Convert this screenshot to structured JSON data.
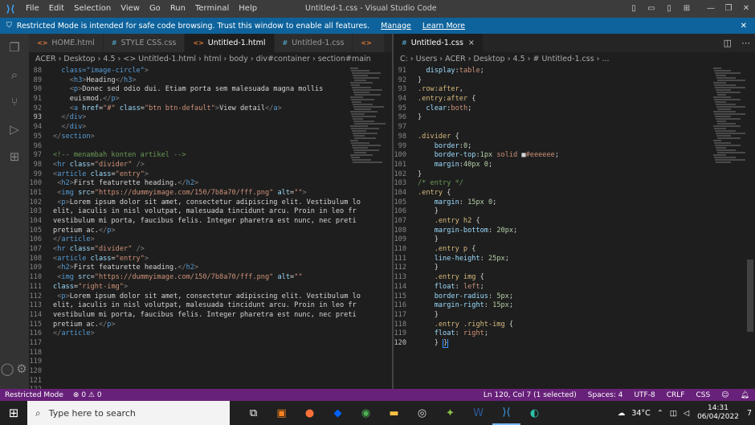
{
  "titlebar": {
    "logo": "vscode-icon",
    "menu": [
      "File",
      "Edit",
      "Selection",
      "View",
      "Go",
      "Run",
      "Terminal",
      "Help"
    ],
    "title": "Untitled-1.css - Visual Studio Code",
    "controls": {
      "minimize": "—",
      "restore": "❐",
      "close": "✕"
    }
  },
  "banner": {
    "text": "Restricted Mode is intended for safe code browsing. Trust this window to enable all features.",
    "manage": "Manage",
    "learn_more": "Learn More"
  },
  "left_tabs": [
    {
      "icon": "<>",
      "label": "HOME.html",
      "kind": "html"
    },
    {
      "icon": "#",
      "label": "STYLE CSS.css",
      "kind": "css"
    },
    {
      "icon": "<>",
      "label": "Untitled-1.html",
      "kind": "html"
    },
    {
      "icon": "#",
      "label": "Untitled-1.css",
      "kind": "css"
    },
    {
      "icon": "<>",
      "label": "",
      "kind": "html"
    }
  ],
  "right_tab": {
    "icon": "#",
    "label": "Untitled-1.css",
    "close": "×"
  },
  "breadcrumb_left": "ACER › Desktop › 4.5 › <> Untitled-1.html › html › body › div#container › section#main",
  "breadcrumb_right": "C: › Users › ACER › Desktop › 4.5 › # Untitled-1.css › ...",
  "left_code": [
    {
      "n": "88",
      "h": "  <span class='t'>class=\"image-circle\"</span><span class='g'>&gt;</span>"
    },
    {
      "n": "89",
      "h": "    <span class='g'>&lt;</span><span class='t'>h3</span><span class='g'>&gt;</span><span class='w'>Heading</span><span class='g'>&lt;/</span><span class='t'>h3</span><span class='g'>&gt;</span>"
    },
    {
      "n": "90",
      "h": "    <span class='g'>&lt;</span><span class='t'>p</span><span class='g'>&gt;</span><span class='w'>Donec sed odio dui. Etiam porta sem malesuada magna mollis</span>"
    },
    {
      "n": "91",
      "h": "    <span class='w'>euismod.</span><span class='g'>&lt;/</span><span class='t'>p</span><span class='g'>&gt;</span>"
    },
    {
      "n": "92",
      "h": "    <span class='g'>&lt;</span><span class='t'>a</span> <span class='a'>href</span><span class='w'>=</span><span class='s'>\"#\"</span> <span class='a'>class</span><span class='w'>=</span><span class='s'>\"btn btn-default\"</span><span class='g'>&gt;</span><span class='w'>View detail</span><span class='g'>&lt;/</span><span class='t'>a</span><span class='g'>&gt;</span>"
    },
    {
      "n": "93",
      "h": "  <span class='g'>&lt;/</span><span class='t'>div</span><span class='g'>&gt;</span>",
      "cur": true
    },
    {
      "n": "94",
      "h": "  <span class='g'>&lt;/</span><span class='t'>div</span><span class='g'>&gt;</span>"
    },
    {
      "n": "95",
      "h": "<span class='g'>&lt;/</span><span class='t'>section</span><span class='g'>&gt;</span>"
    },
    {
      "n": "96",
      "h": ""
    },
    {
      "n": "97",
      "h": "<span class='c'>&lt;!-- menambah konten artikel --&gt;</span>"
    },
    {
      "n": "98",
      "h": "<span class='g'>&lt;</span><span class='t'>hr</span> <span class='a'>class</span><span class='w'>=</span><span class='s'>\"divider\"</span> <span class='g'>/&gt;</span>"
    },
    {
      "n": "99",
      "h": "<span class='g'>&lt;</span><span class='t'>article</span> <span class='a'>class</span><span class='w'>=</span><span class='s'>\"entry\"</span><span class='g'>&gt;</span>"
    },
    {
      "n": "100",
      "h": " <span class='g'>&lt;</span><span class='t'>h2</span><span class='g'>&gt;</span><span class='w'>First featurette heading.</span><span class='g'>&lt;/</span><span class='t'>h2</span><span class='g'>&gt;</span>"
    },
    {
      "n": "101",
      "h": " <span class='g'>&lt;</span><span class='t'>img</span> <span class='a'>src</span><span class='w'>=</span><span class='s'>\"https://dummyimage.com/150/7b8a70/fff.png\"</span> <span class='a'>alt</span><span class='w'>=</span><span class='s'>\"\"</span><span class='g'>&gt;</span>"
    },
    {
      "n": "102",
      "h": " <span class='g'>&lt;</span><span class='t'>p</span><span class='g'>&gt;</span><span class='w'>Lorem ipsum dolor sit amet, consectetur adipiscing elit. Vestibulum lo</span>"
    },
    {
      "n": "103",
      "h": "<span class='w'>elit, iaculis in nisl volutpat, malesuada tincidunt arcu. Proin in leo fr</span>"
    },
    {
      "n": "104",
      "h": "<span class='w'>vestibulum mi porta, faucibus felis. Integer pharetra est nunc, nec preti</span>"
    },
    {
      "n": "105",
      "h": "<span class='w'>pretium ac.</span><span class='g'>&lt;/</span><span class='t'>p</span><span class='g'>&gt;</span>"
    },
    {
      "n": "106",
      "h": "<span class='g'>&lt;/</span><span class='t'>article</span><span class='g'>&gt;</span>"
    },
    {
      "n": "107",
      "h": "<span class='g'>&lt;</span><span class='t'>hr</span> <span class='a'>class</span><span class='w'>=</span><span class='s'>\"divider\"</span> <span class='g'>/&gt;</span>"
    },
    {
      "n": "108",
      "h": "<span class='g'>&lt;</span><span class='t'>article</span> <span class='a'>class</span><span class='w'>=</span><span class='s'>\"entry\"</span><span class='g'>&gt;</span>"
    },
    {
      "n": "109",
      "h": " <span class='g'>&lt;</span><span class='t'>h2</span><span class='g'>&gt;</span><span class='w'>First featurette heading.</span><span class='g'>&lt;/</span><span class='t'>h2</span><span class='g'>&gt;</span>"
    },
    {
      "n": "110",
      "h": " <span class='g'>&lt;</span><span class='t'>img</span> <span class='a'>src</span><span class='w'>=</span><span class='s'>\"https://dummyimage.com/150/7b8a70/fff.png\"</span> <span class='a'>alt</span><span class='w'>=</span><span class='s'>\"\"</span>"
    },
    {
      "n": "111",
      "h": "<span class='a'>class</span><span class='w'>=</span><span class='s'>\"right-img\"</span><span class='g'>&gt;</span>"
    },
    {
      "n": "112",
      "h": " <span class='g'>&lt;</span><span class='t'>p</span><span class='g'>&gt;</span><span class='w'>Lorem ipsum dolor sit amet, consectetur adipiscing elit. Vestibulum lo</span>"
    },
    {
      "n": "113",
      "h": "<span class='w'>elit, iaculis in nisl volutpat, malesuada tincidunt arcu. Proin in leo fr</span>"
    },
    {
      "n": "114",
      "h": "<span class='w'>vestibulum mi porta, faucibus felis. Integer pharetra est nunc, nec preti</span>"
    },
    {
      "n": "115",
      "h": "<span class='w'>pretium ac.</span><span class='g'>&lt;/</span><span class='t'>p</span><span class='g'>&gt;</span>"
    },
    {
      "n": "116",
      "h": "<span class='g'>&lt;/</span><span class='t'>article</span><span class='g'>&gt;</span>"
    },
    {
      "n": "117",
      "h": ""
    },
    {
      "n": "118",
      "h": ""
    },
    {
      "n": "119",
      "h": ""
    },
    {
      "n": "120",
      "h": ""
    },
    {
      "n": "121",
      "h": ""
    },
    {
      "n": "122",
      "h": ""
    }
  ],
  "right_code": [
    {
      "n": "91",
      "h": "  <span class='p'>display</span><span class='w'>:</span><span class='v'>table</span><span class='w'>;</span>"
    },
    {
      "n": "92",
      "h": "<span class='w'>}</span>"
    },
    {
      "n": "93",
      "h": "<span class='sel'>.row:after</span><span class='w'>,</span>"
    },
    {
      "n": "94",
      "h": "<span class='sel'>.entry:after</span> <span class='w'>{</span>"
    },
    {
      "n": "95",
      "h": "  <span class='p'>clear</span><span class='w'>:</span><span class='v'>both</span><span class='w'>;</span>"
    },
    {
      "n": "96",
      "h": "<span class='w'>}</span>"
    },
    {
      "n": "97",
      "h": ""
    },
    {
      "n": "98",
      "h": "<span class='sel'>.divider</span> <span class='w'>{</span>"
    },
    {
      "n": "99",
      "h": "    <span class='p'>border</span><span class='w'>:</span><span class='n'>0</span><span class='w'>;</span>"
    },
    {
      "n": "100",
      "h": "    <span class='p'>border-top</span><span class='w'>:</span><span class='n'>1px</span> <span class='v'>solid</span> <span class='w'>■</span><span class='v'>#eeeeee</span><span class='w'>;</span>"
    },
    {
      "n": "101",
      "h": "    <span class='p'>margin</span><span class='w'>:</span><span class='n'>40px 0</span><span class='w'>;</span>"
    },
    {
      "n": "102",
      "h": "<span class='w'>}</span>"
    },
    {
      "n": "103",
      "h": "<span class='c'>/* entry */</span>"
    },
    {
      "n": "104",
      "h": "<span class='sel'>.entry</span> <span class='w'>{</span>"
    },
    {
      "n": "105",
      "h": "    <span class='p'>margin</span><span class='w'>: </span><span class='n'>15px 0</span><span class='w'>;</span>"
    },
    {
      "n": "106",
      "h": "    <span class='w'>}</span>"
    },
    {
      "n": "107",
      "h": "    <span class='sel'>.entry h2</span> <span class='w'>{</span>"
    },
    {
      "n": "108",
      "h": "    <span class='p'>margin-bottom</span><span class='w'>: </span><span class='n'>20px</span><span class='w'>;</span>"
    },
    {
      "n": "109",
      "h": "    <span class='w'>}</span>"
    },
    {
      "n": "110",
      "h": "    <span class='sel'>.entry p</span> <span class='w'>{</span>"
    },
    {
      "n": "111",
      "h": "    <span class='p'>line-height</span><span class='w'>: </span><span class='n'>25px</span><span class='w'>;</span>"
    },
    {
      "n": "112",
      "h": "    <span class='w'>}</span>"
    },
    {
      "n": "113",
      "h": "    <span class='sel'>.entry img</span> <span class='w'>{</span>"
    },
    {
      "n": "114",
      "h": "    <span class='p'>float</span><span class='w'>: </span><span class='v'>left</span><span class='w'>;</span>"
    },
    {
      "n": "115",
      "h": "    <span class='p'>border-radius</span><span class='w'>: </span><span class='n'>5px</span><span class='w'>;</span>"
    },
    {
      "n": "116",
      "h": "    <span class='p'>margin-right</span><span class='w'>: </span><span class='n'>15px</span><span class='w'>;</span>"
    },
    {
      "n": "117",
      "h": "    <span class='w'>}</span>"
    },
    {
      "n": "118",
      "h": "    <span class='sel'>.entry .right-img</span> <span class='w'>{</span>"
    },
    {
      "n": "119",
      "h": "    <span class='p'>float</span><span class='w'>: </span><span class='v'>right</span><span class='w'>;</span>"
    },
    {
      "n": "120",
      "h": "    <span class='w'>} </span><span class='w' style='border:1px solid #3794ff'>}</span>",
      "cur": true
    }
  ],
  "statusbar": {
    "restricted": "Restricted Mode",
    "problems": "⊗ 0 ⚠ 0",
    "position": "Ln 120, Col 7 (1 selected)",
    "spaces": "Spaces: 4",
    "encoding": "UTF-8",
    "eol": "CRLF",
    "language": "CSS"
  },
  "taskbar": {
    "search_placeholder": "Type here to search",
    "temperature": "34°C",
    "time": "14:31",
    "date": "06/04/2022",
    "notifications": "7"
  },
  "colors": {
    "accent": "#0e639c",
    "statusbar": "#68217a"
  }
}
